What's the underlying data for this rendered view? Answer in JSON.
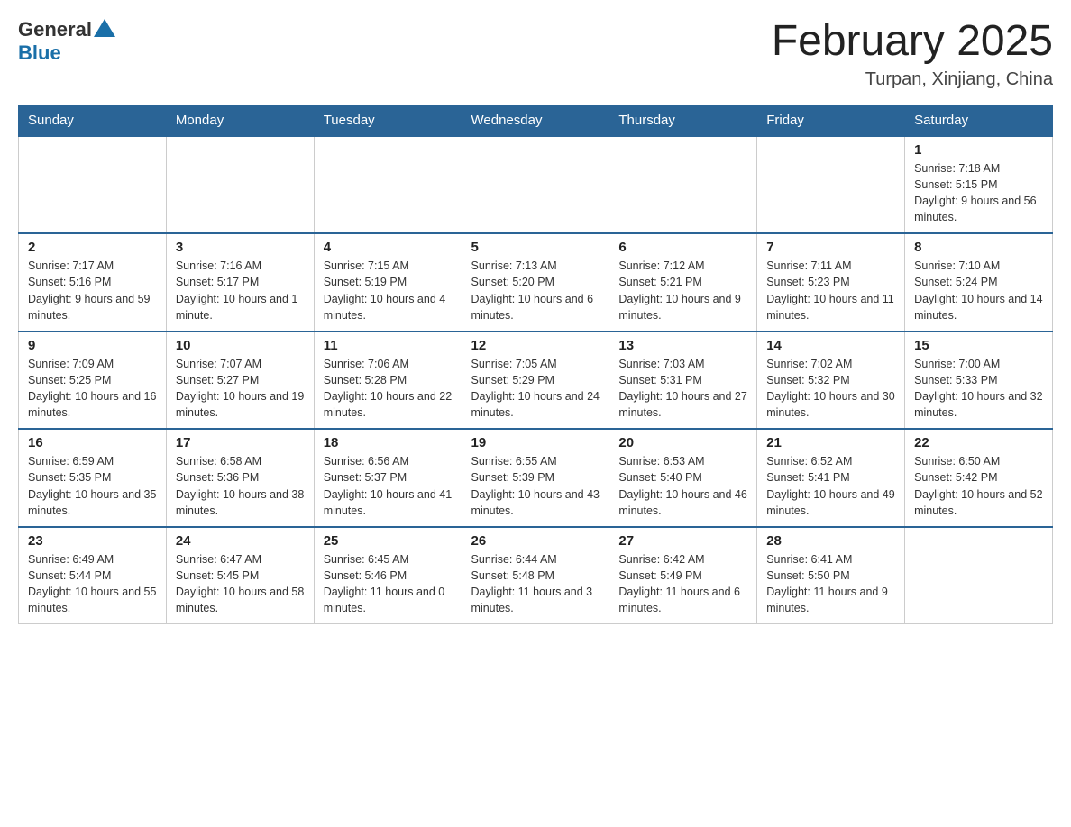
{
  "header": {
    "logo_general": "General",
    "logo_blue": "Blue",
    "month_title": "February 2025",
    "location": "Turpan, Xinjiang, China"
  },
  "weekdays": [
    "Sunday",
    "Monday",
    "Tuesday",
    "Wednesday",
    "Thursday",
    "Friday",
    "Saturday"
  ],
  "weeks": [
    [
      {
        "day": "",
        "info": ""
      },
      {
        "day": "",
        "info": ""
      },
      {
        "day": "",
        "info": ""
      },
      {
        "day": "",
        "info": ""
      },
      {
        "day": "",
        "info": ""
      },
      {
        "day": "",
        "info": ""
      },
      {
        "day": "1",
        "info": "Sunrise: 7:18 AM\nSunset: 5:15 PM\nDaylight: 9 hours and 56 minutes."
      }
    ],
    [
      {
        "day": "2",
        "info": "Sunrise: 7:17 AM\nSunset: 5:16 PM\nDaylight: 9 hours and 59 minutes."
      },
      {
        "day": "3",
        "info": "Sunrise: 7:16 AM\nSunset: 5:17 PM\nDaylight: 10 hours and 1 minute."
      },
      {
        "day": "4",
        "info": "Sunrise: 7:15 AM\nSunset: 5:19 PM\nDaylight: 10 hours and 4 minutes."
      },
      {
        "day": "5",
        "info": "Sunrise: 7:13 AM\nSunset: 5:20 PM\nDaylight: 10 hours and 6 minutes."
      },
      {
        "day": "6",
        "info": "Sunrise: 7:12 AM\nSunset: 5:21 PM\nDaylight: 10 hours and 9 minutes."
      },
      {
        "day": "7",
        "info": "Sunrise: 7:11 AM\nSunset: 5:23 PM\nDaylight: 10 hours and 11 minutes."
      },
      {
        "day": "8",
        "info": "Sunrise: 7:10 AM\nSunset: 5:24 PM\nDaylight: 10 hours and 14 minutes."
      }
    ],
    [
      {
        "day": "9",
        "info": "Sunrise: 7:09 AM\nSunset: 5:25 PM\nDaylight: 10 hours and 16 minutes."
      },
      {
        "day": "10",
        "info": "Sunrise: 7:07 AM\nSunset: 5:27 PM\nDaylight: 10 hours and 19 minutes."
      },
      {
        "day": "11",
        "info": "Sunrise: 7:06 AM\nSunset: 5:28 PM\nDaylight: 10 hours and 22 minutes."
      },
      {
        "day": "12",
        "info": "Sunrise: 7:05 AM\nSunset: 5:29 PM\nDaylight: 10 hours and 24 minutes."
      },
      {
        "day": "13",
        "info": "Sunrise: 7:03 AM\nSunset: 5:31 PM\nDaylight: 10 hours and 27 minutes."
      },
      {
        "day": "14",
        "info": "Sunrise: 7:02 AM\nSunset: 5:32 PM\nDaylight: 10 hours and 30 minutes."
      },
      {
        "day": "15",
        "info": "Sunrise: 7:00 AM\nSunset: 5:33 PM\nDaylight: 10 hours and 32 minutes."
      }
    ],
    [
      {
        "day": "16",
        "info": "Sunrise: 6:59 AM\nSunset: 5:35 PM\nDaylight: 10 hours and 35 minutes."
      },
      {
        "day": "17",
        "info": "Sunrise: 6:58 AM\nSunset: 5:36 PM\nDaylight: 10 hours and 38 minutes."
      },
      {
        "day": "18",
        "info": "Sunrise: 6:56 AM\nSunset: 5:37 PM\nDaylight: 10 hours and 41 minutes."
      },
      {
        "day": "19",
        "info": "Sunrise: 6:55 AM\nSunset: 5:39 PM\nDaylight: 10 hours and 43 minutes."
      },
      {
        "day": "20",
        "info": "Sunrise: 6:53 AM\nSunset: 5:40 PM\nDaylight: 10 hours and 46 minutes."
      },
      {
        "day": "21",
        "info": "Sunrise: 6:52 AM\nSunset: 5:41 PM\nDaylight: 10 hours and 49 minutes."
      },
      {
        "day": "22",
        "info": "Sunrise: 6:50 AM\nSunset: 5:42 PM\nDaylight: 10 hours and 52 minutes."
      }
    ],
    [
      {
        "day": "23",
        "info": "Sunrise: 6:49 AM\nSunset: 5:44 PM\nDaylight: 10 hours and 55 minutes."
      },
      {
        "day": "24",
        "info": "Sunrise: 6:47 AM\nSunset: 5:45 PM\nDaylight: 10 hours and 58 minutes."
      },
      {
        "day": "25",
        "info": "Sunrise: 6:45 AM\nSunset: 5:46 PM\nDaylight: 11 hours and 0 minutes."
      },
      {
        "day": "26",
        "info": "Sunrise: 6:44 AM\nSunset: 5:48 PM\nDaylight: 11 hours and 3 minutes."
      },
      {
        "day": "27",
        "info": "Sunrise: 6:42 AM\nSunset: 5:49 PM\nDaylight: 11 hours and 6 minutes."
      },
      {
        "day": "28",
        "info": "Sunrise: 6:41 AM\nSunset: 5:50 PM\nDaylight: 11 hours and 9 minutes."
      },
      {
        "day": "",
        "info": ""
      }
    ]
  ]
}
